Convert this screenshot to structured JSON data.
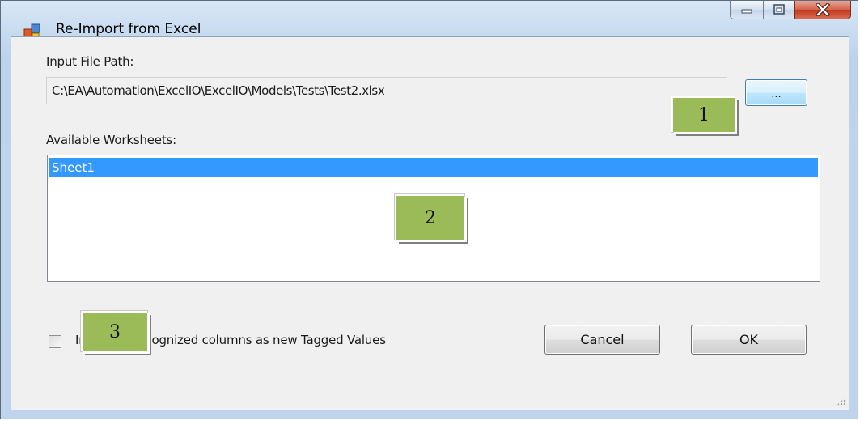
{
  "window": {
    "title": "Re-Import from Excel",
    "icon": "excel-app-icon",
    "caption_buttons": [
      "minimize-icon",
      "maximize-icon",
      "close-icon"
    ]
  },
  "form": {
    "input_path_label": "Input File Path:",
    "input_path_value": "C:\\EA\\Automation\\ExcelIO\\ExcelIO\\Models\\Tests\\Test2.xlsx",
    "browse_label": "...",
    "worksheets_label": "Available Worksheets:",
    "worksheets": [
      {
        "label": "Sheet1",
        "selected": true
      }
    ],
    "checkbox_label": "Import unrecognized columns as new Tagged Values",
    "checkbox_checked": false,
    "cancel_label": "Cancel",
    "ok_label": "OK"
  },
  "callouts": {
    "c1": "1",
    "c2": "2",
    "c3": "3"
  },
  "colors": {
    "selection": "#3399ff",
    "callout": "#9bbb59",
    "close_button": "#c4381f"
  }
}
